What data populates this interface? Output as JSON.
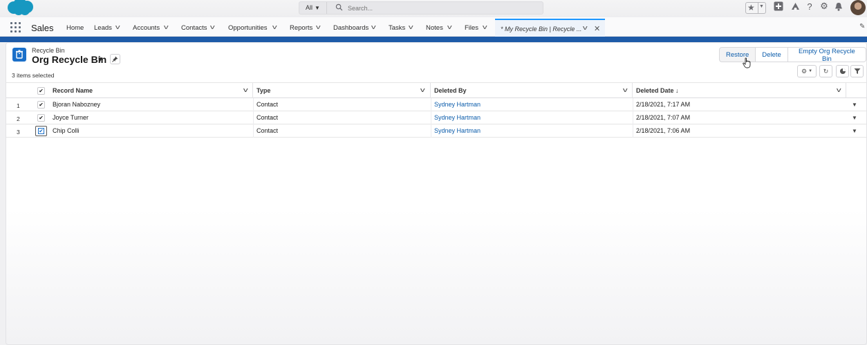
{
  "header": {
    "search_scope": "All",
    "search_placeholder": "Search..."
  },
  "nav": {
    "app_name": "Sales",
    "items": [
      {
        "label": "Home"
      },
      {
        "label": "Leads"
      },
      {
        "label": "Accounts"
      },
      {
        "label": "Contacts"
      },
      {
        "label": "Opportunities"
      },
      {
        "label": "Reports"
      },
      {
        "label": "Dashboards"
      },
      {
        "label": "Tasks"
      },
      {
        "label": "Notes"
      },
      {
        "label": "Files"
      }
    ],
    "active_tab": "* My Recycle Bin | Recycle ..."
  },
  "page": {
    "object_label": "Recycle Bin",
    "title": "Org Recycle Bin",
    "selected_count": "3 items selected",
    "buttons": {
      "restore": "Restore",
      "delete": "Delete",
      "empty": "Empty Org Recycle Bin"
    }
  },
  "table": {
    "columns": [
      "Record Name",
      "Type",
      "Deleted By",
      "Deleted Date ↓"
    ],
    "rows": [
      {
        "num": "1",
        "name": "Bjoran Nabozney",
        "type": "Contact",
        "deleted_by": "Sydney Hartman",
        "deleted_date": "2/18/2021, 7:17 AM",
        "checked": true
      },
      {
        "num": "2",
        "name": "Joyce Turner",
        "type": "Contact",
        "deleted_by": "Sydney Hartman",
        "deleted_date": "2/18/2021, 7:07 AM",
        "checked": true
      },
      {
        "num": "3",
        "name": "Chip Colli",
        "type": "Contact",
        "deleted_by": "Sydney Hartman",
        "deleted_date": "2/18/2021, 7:06 AM",
        "checked": true
      }
    ]
  },
  "colors": {
    "brand_band": "#1e5ba8",
    "link": "#0b5cab",
    "active_tab_accent": "#1b96ff",
    "object_icon": "#1a6fc9"
  }
}
